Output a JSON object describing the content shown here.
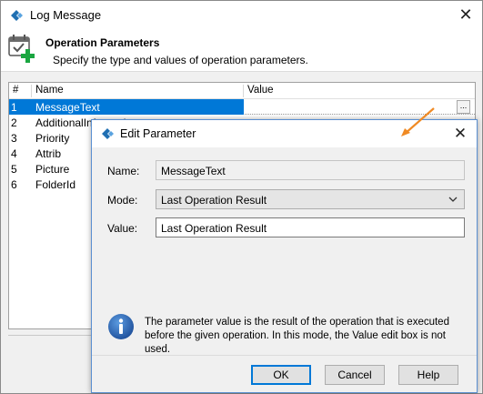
{
  "window": {
    "title": "Log Message",
    "close_glyph": "✕"
  },
  "header": {
    "title": "Operation Parameters",
    "description": "Specify the type and values of operation parameters."
  },
  "table": {
    "columns": {
      "num": "#",
      "name": "Name",
      "value": "Value"
    },
    "rows": [
      {
        "num": "1",
        "name": "MessageText",
        "value": "",
        "selected": true
      },
      {
        "num": "2",
        "name": "AdditionalInformation",
        "value": ""
      },
      {
        "num": "3",
        "name": "Priority",
        "value": ""
      },
      {
        "num": "4",
        "name": "Attrib",
        "value": ""
      },
      {
        "num": "5",
        "name": "Picture",
        "value": ""
      },
      {
        "num": "6",
        "name": "FolderId",
        "value": ""
      }
    ],
    "ellipsis_label": "..."
  },
  "dialog": {
    "title": "Edit Parameter",
    "close_glyph": "✕",
    "name_label": "Name:",
    "name_value": "MessageText",
    "mode_label": "Mode:",
    "mode_value": "Last Operation Result",
    "value_label": "Value:",
    "value_value": "Last Operation Result",
    "info_text": "The parameter value is the result of the operation that is executed before the given operation. In this mode, the Value edit box is not used.",
    "buttons": {
      "ok": "OK",
      "cancel": "Cancel",
      "help": "Help"
    }
  },
  "colors": {
    "selection": "#0078d7",
    "arrow": "#f08a24",
    "info_icon": "#1e63b5",
    "brand_icon": "#1f6fb2"
  },
  "icons": {
    "app": "testcomplete-logo-icon",
    "header": "calendar-add-icon",
    "info": "info-icon",
    "chevron": "chevron-down-icon"
  }
}
